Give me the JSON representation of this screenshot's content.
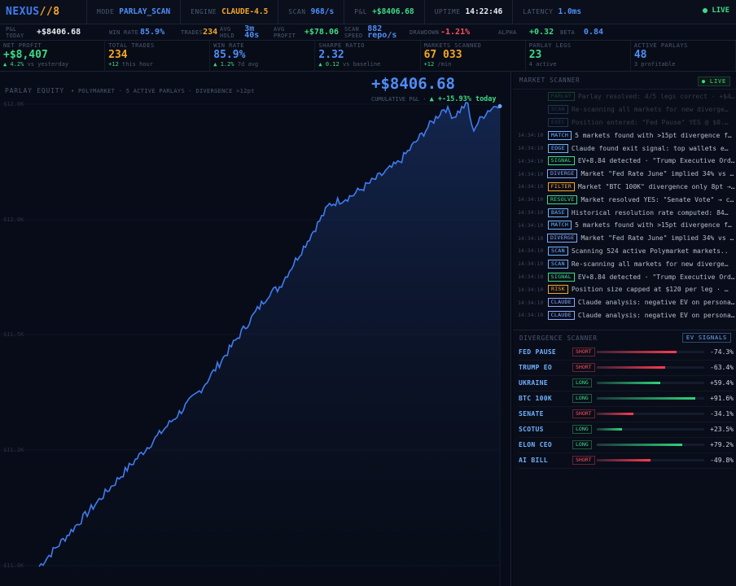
{
  "topbar": {
    "logo_main": "NEXUS",
    "logo_slash": "//8",
    "items": [
      {
        "label": "MODE",
        "value": "PARLAY_SCAN",
        "color": "#4f8ef7"
      },
      {
        "label": "ENGINE",
        "value": "CLAUDE-4.5",
        "color": "#f5a623"
      },
      {
        "label": "SCAN",
        "value": "968/s",
        "color": "#4f8ef7"
      },
      {
        "label": "P&L",
        "value": "+$8406.68",
        "color": "#3ddc84"
      },
      {
        "label": "UPTIME",
        "value": "14:22:46",
        "color": "#e8ecf5"
      },
      {
        "label": "LATENCY",
        "value": "1.0ms",
        "color": "#4f8ef7"
      }
    ],
    "live": "LIVE"
  },
  "row2": [
    {
      "label": "P&L TODAY",
      "value": "+$8406.68",
      "color": "#e8ecf5"
    },
    {
      "label": "WIN RATE",
      "value": "85.9%",
      "color": "#4f8ef7"
    },
    {
      "label": "TRADES",
      "value": "234",
      "color": "#f5a623"
    },
    {
      "label": "AVG HOLD",
      "value": "3m 40s",
      "color": "#4f8ef7"
    },
    {
      "label": "AVG PROFIT",
      "value": "+$78.06",
      "color": "#3ddc84"
    },
    {
      "label": "SCAN SPEED",
      "value": "882 repo/s",
      "color": "#4f8ef7"
    },
    {
      "label": "DRAWDOWN",
      "value": "-1.21%",
      "color": "#ff4d5e"
    },
    {
      "label": "ALPHA",
      "value": "+0.32",
      "color": "#3ddc84"
    },
    {
      "label": "BETA",
      "value": "0.84",
      "color": "#4f8ef7"
    }
  ],
  "kpis": [
    {
      "label": "NET PROFIT",
      "value": "+$8,407",
      "color": "#3ddc84",
      "sub_up": "▲ 4.2%",
      "sub": "vs yesterday"
    },
    {
      "label": "TOTAL TRADES",
      "value": "234",
      "color": "#f5a623",
      "sub_up": "+12",
      "sub": "this hour"
    },
    {
      "label": "WIN RATE",
      "value": "85.9%",
      "color": "#4f8ef7",
      "sub_up": "▲ 1.2%",
      "sub": "7d avg"
    },
    {
      "label": "SHARPE RATIO",
      "value": "2.32",
      "color": "#4f8ef7",
      "sub_up": "▲ 0.12",
      "sub": "vs baseline"
    },
    {
      "label": "MARKETS SCANNED",
      "value": "67 033",
      "color": "#f5a623",
      "sub_up": "+12",
      "sub": "/min"
    },
    {
      "label": "PARLAY LEGS",
      "value": "23",
      "color": "#3ddc84",
      "sub_up": "",
      "sub": "4 active"
    },
    {
      "label": "ACTIVE PARLAYS",
      "value": "48",
      "color": "#4f8ef7",
      "sub_up": "",
      "sub": "3 profitable"
    }
  ],
  "equity": {
    "title": "PARLAY EQUITY",
    "subtitle": "• POLYMARKET · 5 ACTIVE PARLAYS · DIVERGENCE >12pt",
    "big_value": "+$8406.68",
    "caption": "CUMULATIVE P&L ·",
    "change": "▲ +-15.93% today",
    "y_labels": [
      "$12.0K",
      "$12.0K",
      "$11.5K",
      "$11.2K",
      "$11.0K"
    ],
    "line_color": "#3f7cf0"
  },
  "scanner": {
    "title": "MARKET SCANNER",
    "live": "● LIVE",
    "rows": [
      {
        "time": "",
        "tag": "PARLAY",
        "type": "pnl",
        "msg": "Parlay resolved: 4/5 legs correct · +$4..",
        "faded": true
      },
      {
        "time": "",
        "tag": "SCAN",
        "type": "scan",
        "msg": "Re-scanning all markets for new divergen..",
        "faded": true
      },
      {
        "time": "",
        "tag": "EXEC",
        "type": "exec",
        "msg": "Position entered: \"Fed Pause\" YES @ $0.4..",
        "faded": true
      },
      {
        "time": "14:34:10",
        "tag": "MATCH",
        "type": "match",
        "msg": "5 markets found with >15pt divergence fr..",
        "faded": false
      },
      {
        "time": "14:34:10",
        "tag": "EDGE",
        "type": "edge",
        "msg": "Claude found exit signal: top wallets ex..",
        "faded": false
      },
      {
        "time": "14:34:10",
        "tag": "SIGNAL",
        "type": "signal",
        "msg": "EV+8.84 detected · \"Trump Executive Ord..",
        "faded": false
      },
      {
        "time": "14:34:10",
        "tag": "DIVERGE",
        "type": "diverge",
        "msg": "Market \"Fed Rate June\" implied 34% vs ..",
        "faded": false
      },
      {
        "time": "14:34:10",
        "tag": "FILTER",
        "type": "filter",
        "msg": "Market \"BTC 100K\" divergence only 8pt →..",
        "faded": false
      },
      {
        "time": "14:34:10",
        "tag": "RESOLVE",
        "type": "resolve",
        "msg": "Market resolved YES: \"Senate Vote\" → c..",
        "faded": false
      },
      {
        "time": "14:34:10",
        "tag": "BASE",
        "type": "base",
        "msg": "Historical resolution rate computed: 847..",
        "faded": false
      },
      {
        "time": "14:34:10",
        "tag": "MATCH",
        "type": "match",
        "msg": "5 markets found with >15pt divergence fr..",
        "faded": false
      },
      {
        "time": "14:34:10",
        "tag": "DIVERGE",
        "type": "diverge",
        "msg": "Market \"Fed Rate June\" implied 34% vs ..",
        "faded": false
      },
      {
        "time": "14:34:10",
        "tag": "SCAN",
        "type": "scan",
        "msg": "Scanning 524 active Polymarket markets..",
        "faded": false
      },
      {
        "time": "14:34:10",
        "tag": "SCAN",
        "type": "scan",
        "msg": "Re-scanning all markets for new divergen..",
        "faded": false
      },
      {
        "time": "14:34:10",
        "tag": "SIGNAL",
        "type": "signal",
        "msg": "EV+8.84 detected · \"Trump Executive Ord..",
        "faded": false
      },
      {
        "time": "14:34:10",
        "tag": "RISK",
        "type": "risk",
        "msg": "Position size capped at $120 per leg · K..",
        "faded": false
      },
      {
        "time": "14:34:10",
        "tag": "CLAUDE",
        "type": "claude",
        "msg": "Claude analysis: negative EV on persona..",
        "faded": false
      },
      {
        "time": "14:34:10",
        "tag": "CLAUDE",
        "type": "claude",
        "msg": "Claude analysis: negative EV on persona..",
        "faded": false
      }
    ]
  },
  "divergence": {
    "title": "DIVERGENCE SCANNER",
    "badge": "EV SIGNALS",
    "rows": [
      {
        "name": "FED PAUSE",
        "dir": "SHORT",
        "value": "-74.3%",
        "pct": 74.3
      },
      {
        "name": "TRUMP EO",
        "dir": "SHORT",
        "value": "-63.4%",
        "pct": 63.4
      },
      {
        "name": "UKRAINE",
        "dir": "LONG",
        "value": "+59.4%",
        "pct": 59.4
      },
      {
        "name": "BTC 100K",
        "dir": "LONG",
        "value": "+91.6%",
        "pct": 91.6
      },
      {
        "name": "SENATE",
        "dir": "SHORT",
        "value": "-34.1%",
        "pct": 34.1
      },
      {
        "name": "SCOTUS",
        "dir": "LONG",
        "value": "+23.5%",
        "pct": 23.5
      },
      {
        "name": "ELON CEO",
        "dir": "LONG",
        "value": "+79.2%",
        "pct": 79.2
      },
      {
        "name": "AI BILL",
        "dir": "SHORT",
        "value": "-49.8%",
        "pct": 49.8
      }
    ]
  }
}
